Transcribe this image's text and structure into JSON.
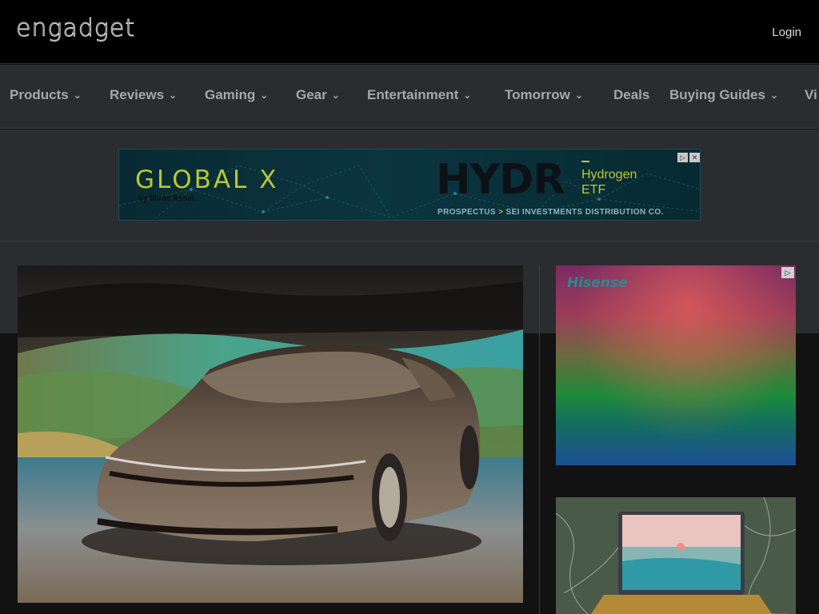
{
  "header": {
    "logo_text": "engadget",
    "login_label": "Login"
  },
  "nav": {
    "items": [
      {
        "label": "Products",
        "has_dropdown": true
      },
      {
        "label": "Reviews",
        "has_dropdown": true
      },
      {
        "label": "Gaming",
        "has_dropdown": true
      },
      {
        "label": "Gear",
        "has_dropdown": true
      },
      {
        "label": "Entertainment",
        "has_dropdown": true
      },
      {
        "label": "Tomorrow",
        "has_dropdown": true
      },
      {
        "label": "Deals",
        "has_dropdown": false
      },
      {
        "label": "Buying Guides",
        "has_dropdown": true
      },
      {
        "label": "Vi",
        "has_dropdown": false
      }
    ],
    "chevron_glyph": "⌄"
  },
  "top_ad": {
    "brand": "GLOBAL X",
    "brand_by": "by Mirae Asset",
    "ticker": "HYDR",
    "fund_line1": "Hydrogen",
    "fund_line2": "ETF",
    "prospectus": "PROSPECTUS",
    "arrow": ">",
    "distributor": "SEI INVESTMENTS DISTRIBUTION CO.",
    "adchoices_icon": "adchoices-icon",
    "close_icon": "close-icon"
  },
  "side_ad": {
    "brand": "Hisense",
    "adchoices_icon": "adchoices-icon"
  },
  "colors": {
    "topbar_bg": "#000000",
    "nav_bg": "#2b2c30",
    "body_dark": "#121212",
    "ad_accent": "#b8c832"
  }
}
